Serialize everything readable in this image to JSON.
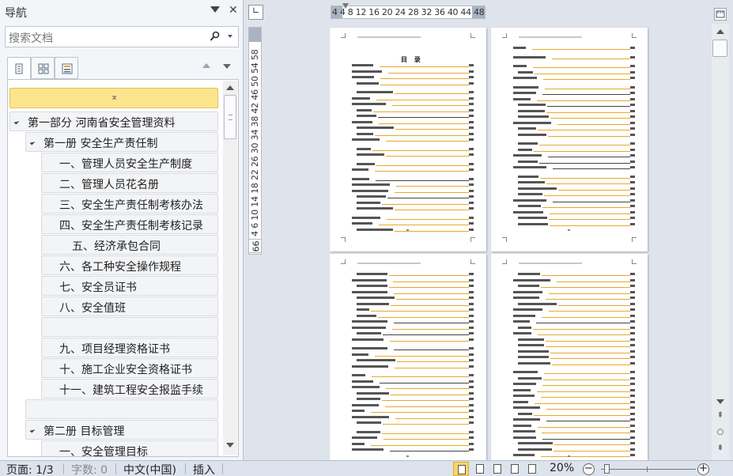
{
  "nav": {
    "title": "导航",
    "search_placeholder": "搜索文档",
    "tree": [
      {
        "label": "第一部分  河南省安全管理资料",
        "level": 0
      },
      {
        "label": "第一册  安全生产责任制",
        "level": 1
      },
      {
        "label": "一、管理人员安全生产制度",
        "level": 2
      },
      {
        "label": "二、管理人员花名册",
        "level": 2
      },
      {
        "label": "三、安全生产责任制考核办法",
        "level": 2
      },
      {
        "label": "四、安全生产责任制考核记录",
        "level": 2
      },
      {
        "label": "五、经济承包合同",
        "level": 3
      },
      {
        "label": "六、各工种安全操作规程",
        "level": 2
      },
      {
        "label": "七、安全员证书",
        "level": 2
      },
      {
        "label": "八、安全值班",
        "level": 2
      },
      {
        "label": "",
        "level": 2
      },
      {
        "label": "九、项目经理资格证书",
        "level": 2
      },
      {
        "label": "十、施工企业安全资格证书",
        "level": 2
      },
      {
        "label": "十一、建筑工程安全报监手续",
        "level": 2
      },
      {
        "label": "",
        "level": 1
      },
      {
        "label": "第二册  目标管理",
        "level": 1
      },
      {
        "label": "一、安全管理目标",
        "level": 2
      }
    ]
  },
  "ruler": {
    "horizontal": "4    4  8  12 16 20 24 28 32 36 40 44  48",
    "vertical": "2  4  6  10 14 18 22 26 30 34 38 42 46 50 54 58",
    "vertical_bottom": "66"
  },
  "pages": {
    "toc_title": "目  录"
  },
  "status": {
    "page": "页面: 1/3",
    "words": "字数: 0",
    "language": "中文(中国)",
    "mode": "插入",
    "zoom": "20%",
    "zoom_value": 20
  }
}
